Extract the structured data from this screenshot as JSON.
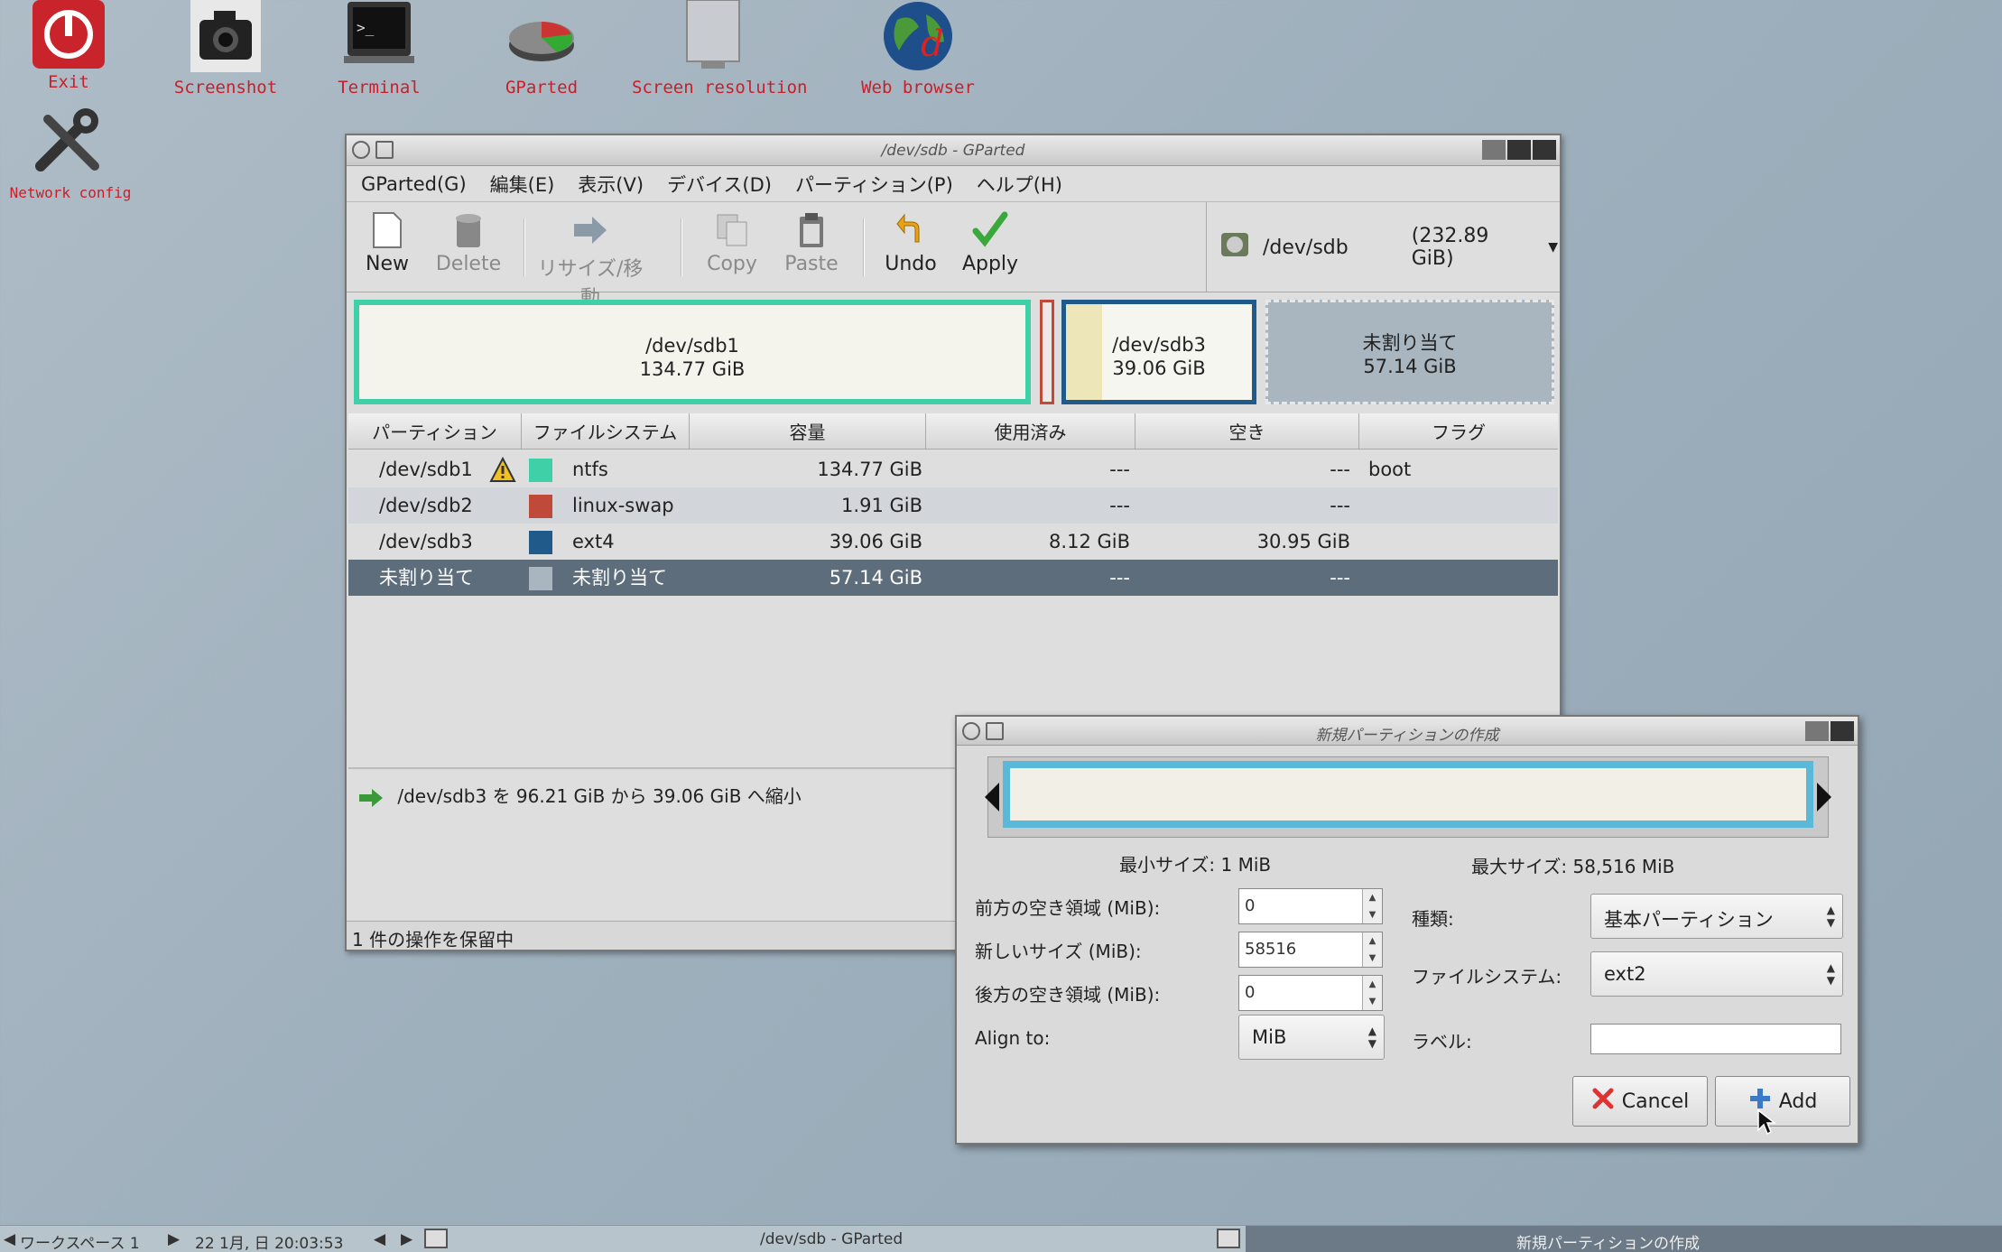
{
  "desktop": {
    "icons": [
      "Exit",
      "Screenshot",
      "Terminal",
      "GParted",
      "Screen resolution",
      "Web browser",
      "Network config"
    ]
  },
  "main_window": {
    "title": "/dev/sdb - GParted",
    "menu": [
      "GParted(G)",
      "編集(E)",
      "表示(V)",
      "デバイス(D)",
      "パーティション(P)",
      "ヘルプ(H)"
    ],
    "toolbar": {
      "new": "New",
      "delete": "Delete",
      "resize": "リサイズ/移動",
      "copy": "Copy",
      "paste": "Paste",
      "undo": "Undo",
      "apply": "Apply"
    },
    "device": {
      "name": "/dev/sdb",
      "size": "(232.89 GiB)"
    },
    "map": {
      "sdb1_name": "/dev/sdb1",
      "sdb1_size": "134.77 GiB",
      "sdb3_name": "/dev/sdb3",
      "sdb3_size": "39.06 GiB",
      "unalloc_name": "未割り当て",
      "unalloc_size": "57.14 GiB"
    },
    "columns": [
      "パーティション",
      "ファイルシステム",
      "容量",
      "使用済み",
      "空き",
      "フラグ"
    ],
    "rows": [
      {
        "partition": "/dev/sdb1",
        "fs": "ntfs",
        "size": "134.77 GiB",
        "used": "---",
        "free": "---",
        "flags": "boot"
      },
      {
        "partition": "/dev/sdb2",
        "fs": "linux-swap",
        "size": "1.91 GiB",
        "used": "---",
        "free": "---",
        "flags": ""
      },
      {
        "partition": "/dev/sdb3",
        "fs": "ext4",
        "size": "39.06 GiB",
        "used": "8.12 GiB",
        "free": "30.95 GiB",
        "flags": ""
      },
      {
        "partition": "未割り当て",
        "fs": "未割り当て",
        "size": "57.14 GiB",
        "used": "---",
        "free": "---",
        "flags": ""
      }
    ],
    "operation": "/dev/sdb3 を 96.21 GiB から 39.06 GiB へ縮小",
    "status": "1 件の操作を保留中"
  },
  "dialog": {
    "title": "新規パーティションの作成",
    "min_size": "最小サイズ: 1 MiB",
    "max_size": "最大サイズ: 58,516 MiB",
    "free_before_label": "前方の空き領域 (MiB):",
    "free_before": "0",
    "new_size_label": "新しいサイズ (MiB):",
    "new_size": "58516",
    "free_after_label": "後方の空き領域 (MiB):",
    "free_after": "0",
    "align_label": "Align to:",
    "align": "MiB",
    "type_label": "種類:",
    "type": "基本パーティション",
    "fs_label": "ファイルシステム:",
    "fs": "ext2",
    "label_label": "ラベル:",
    "label_value": "",
    "cancel": "Cancel",
    "add": "Add"
  },
  "taskbar": {
    "workspace": "ワークスペース 1",
    "datetime": "22 1月, 日 20:03:53",
    "task1": "/dev/sdb - GParted",
    "task2": "新規パーティションの作成"
  },
  "colors": {
    "ntfs": "#3fd0a8",
    "swap": "#c04a3a",
    "ext4": "#1f5a8a",
    "unalloc": "#a9b6c0",
    "selected": "#5d6d7b"
  }
}
